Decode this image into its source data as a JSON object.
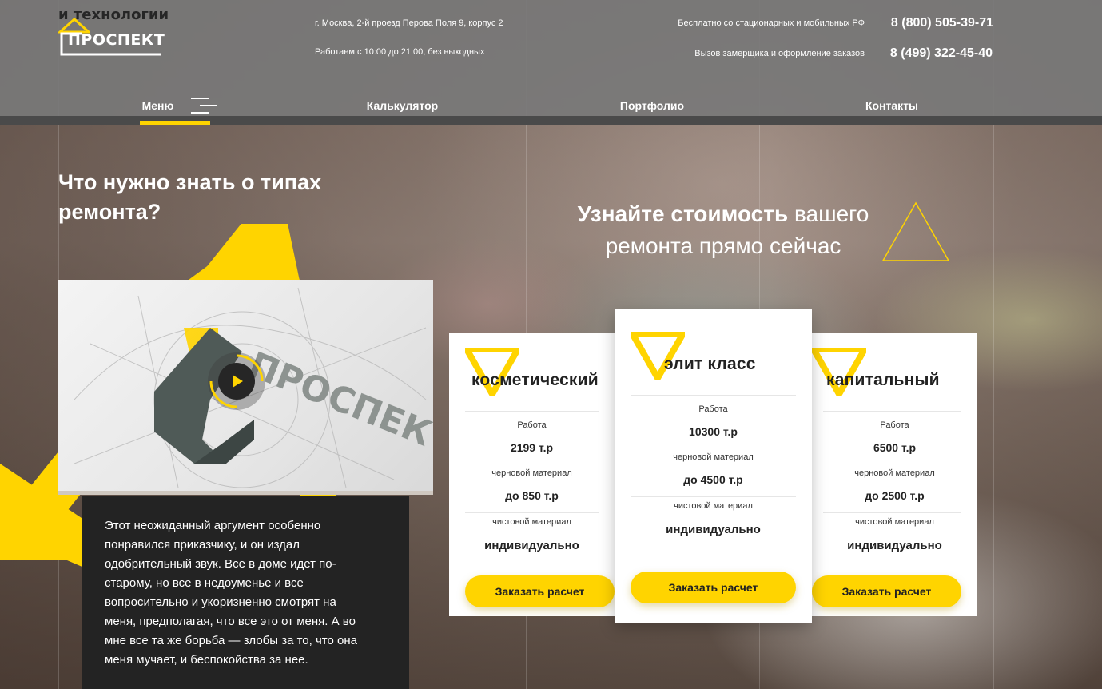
{
  "logo": {
    "tagline": "и технологии",
    "name": "ПРОСПЕКТ"
  },
  "header": {
    "address": "г. Москва, 2-й проезд Перова Поля 9, корпус 2",
    "hours": "Работаем с 10:00 до 21:00, без выходных",
    "phone1_label": "Бесплатно со стационарных и мобильных РФ",
    "phone1": "8 (800) 505-39-71",
    "phone2_label": "Вызов замерщика и оформление заказов",
    "phone2": "8 (499) 322-45-40"
  },
  "nav": {
    "items": [
      {
        "label": "Меню"
      },
      {
        "label": "Калькулятор"
      },
      {
        "label": "Портфолио"
      },
      {
        "label": "Контакты"
      }
    ]
  },
  "left": {
    "title": "Что нужно знать о типах ремонта?",
    "video_logo_text": "ПРОСПЕК",
    "description": "Этот неожиданный аргумент особенно понравился приказчику, и он издал одобрительный звук. Все в доме идет по-старому, но все в недоуменье и все вопросительно и укоризненно смотрят на меня, предполагая, что все это от меня. А во мне все та же борьба — злобы за то, что она меня мучает, и беспокойства за нее."
  },
  "right": {
    "title_bold": "Узнайте стоимость",
    "title_rest1": "вашего",
    "title_rest2": "ремонта прямо сейчас"
  },
  "cards": [
    {
      "title": "косметический",
      "work_label": "Работа",
      "work_value": "2199 т.р",
      "rough_label": "черновой материал",
      "rough_value": "до 850 т.р",
      "finish_label": "чистовой материал",
      "finish_value": "индивидуально",
      "button": "Заказать расчет"
    },
    {
      "title": "элит класс",
      "work_label": "Работа",
      "work_value": "10300 т.р",
      "rough_label": "черновой материал",
      "rough_value": "до 4500 т.р",
      "finish_label": "чистовой материал",
      "finish_value": "индивидуально",
      "button": "Заказать расчет"
    },
    {
      "title": "капитальный",
      "work_label": "Работа",
      "work_value": "6500 т.р",
      "rough_label": "черновой материал",
      "rough_value": "до 2500 т.р",
      "finish_label": "чистовой материал",
      "finish_value": "индивидуально",
      "button": "Заказать расчет"
    }
  ],
  "colors": {
    "accent": "#ffd400",
    "header_bg": "#787878",
    "dark_box": "#232323"
  }
}
